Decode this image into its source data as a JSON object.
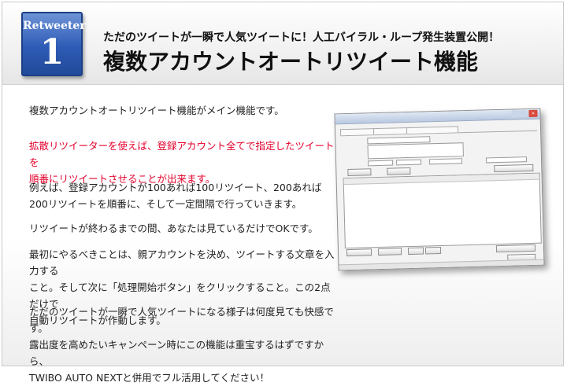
{
  "header": {
    "badge_label": "Retweeter",
    "badge_number": "1",
    "subtitle": "ただのツイートが一瞬で人気ツイートに！人工バイラル・ループ発生装置公開！",
    "title": "複数アカウントオートリツイート機能"
  },
  "paragraphs": [
    {
      "lines": [
        "複数アカウントオートリツイート機能がメイン機能です。"
      ],
      "style": "normal"
    },
    {
      "lines": [
        "拡散リツイーターを使えば、登録アカウント全てで指定したツイートを",
        "順番にリツイートさせることが出来ます。"
      ],
      "style": "red"
    },
    {
      "lines": [
        "例えば、登録アカウントが100あれば100リツイート、200あれば",
        "200リツイートを順番に、そして一定間隔で行っていきます。"
      ],
      "style": "normal"
    },
    {
      "lines": [
        "リツイートが終わるまでの間、あなたは見ているだけでOKです。"
      ],
      "style": "normal"
    },
    {
      "lines": [
        "最初にやるべきことは、親アカウントを決め、ツイートする文章を入力する",
        "こと。そして次に「処理開始ボタン」をクリックすること。この2点だけで",
        "自動リツイートが作動します。"
      ],
      "style": "normal"
    },
    {
      "lines": [
        "ただのツイートが一瞬で人気ツイートになる様子は何度見ても快感です。",
        "露出度を高めたいキャンペーン時にこの機能は重宝するはずですから、",
        "TWIBO AUTO NEXTと併用でフル活用してください！"
      ],
      "style": "normal"
    }
  ],
  "screenshot_window": {
    "close_glyph": "×"
  },
  "colors": {
    "accent_red": "#e4002b",
    "badge_blue": "#2d5bb6"
  }
}
